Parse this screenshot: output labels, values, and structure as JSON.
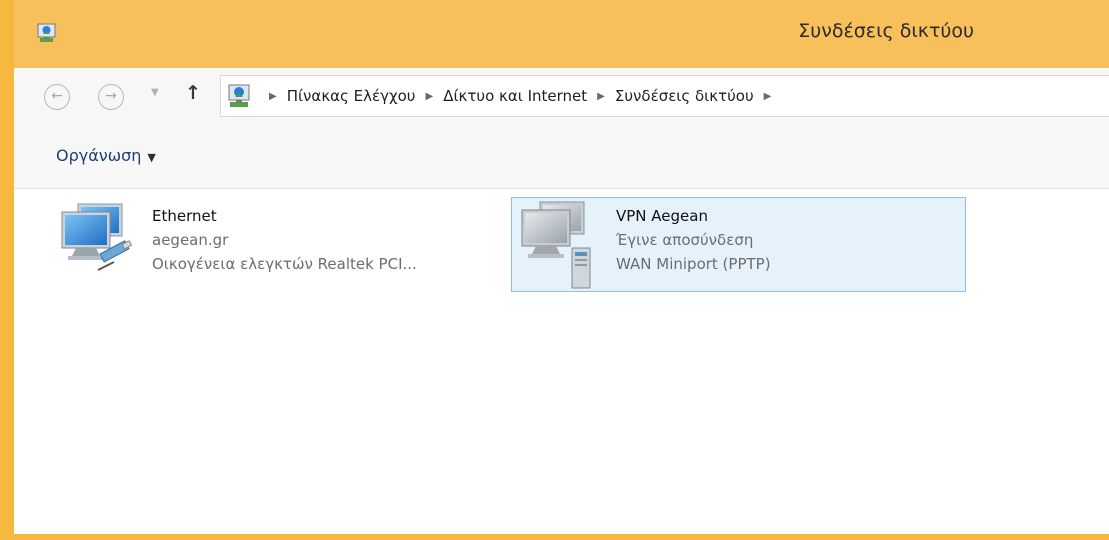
{
  "window": {
    "title": "Συνδέσεις δικτύου"
  },
  "navigation": {
    "back_icon": "back-arrow-icon",
    "forward_icon": "forward-arrow-icon",
    "recent_icon": "chevron-down-icon",
    "up_icon": "up-arrow-icon",
    "breadcrumbs": [
      "Πίνακας Ελέγχου",
      "Δίκτυο και Internet",
      "Συνδέσεις δικτύου"
    ]
  },
  "toolbar": {
    "organize_label": "Οργάνωση"
  },
  "connections": [
    {
      "name": "Ethernet",
      "status": "aegean.gr",
      "device": "Οικογένεια ελεγκτών Realtek PCI...",
      "icon": "ethernet-connection-icon",
      "selected": false
    },
    {
      "name": "VPN Aegean",
      "status": "Έγινε αποσύνδεση",
      "device": "WAN Miniport (PPTP)",
      "icon": "vpn-connection-icon",
      "selected": true
    }
  ],
  "colors": {
    "titlebar": "#f8c05a",
    "frame": "#f6b83f",
    "selection_fill": "#e5f1fb",
    "selection_border": "#8fc0e8"
  }
}
